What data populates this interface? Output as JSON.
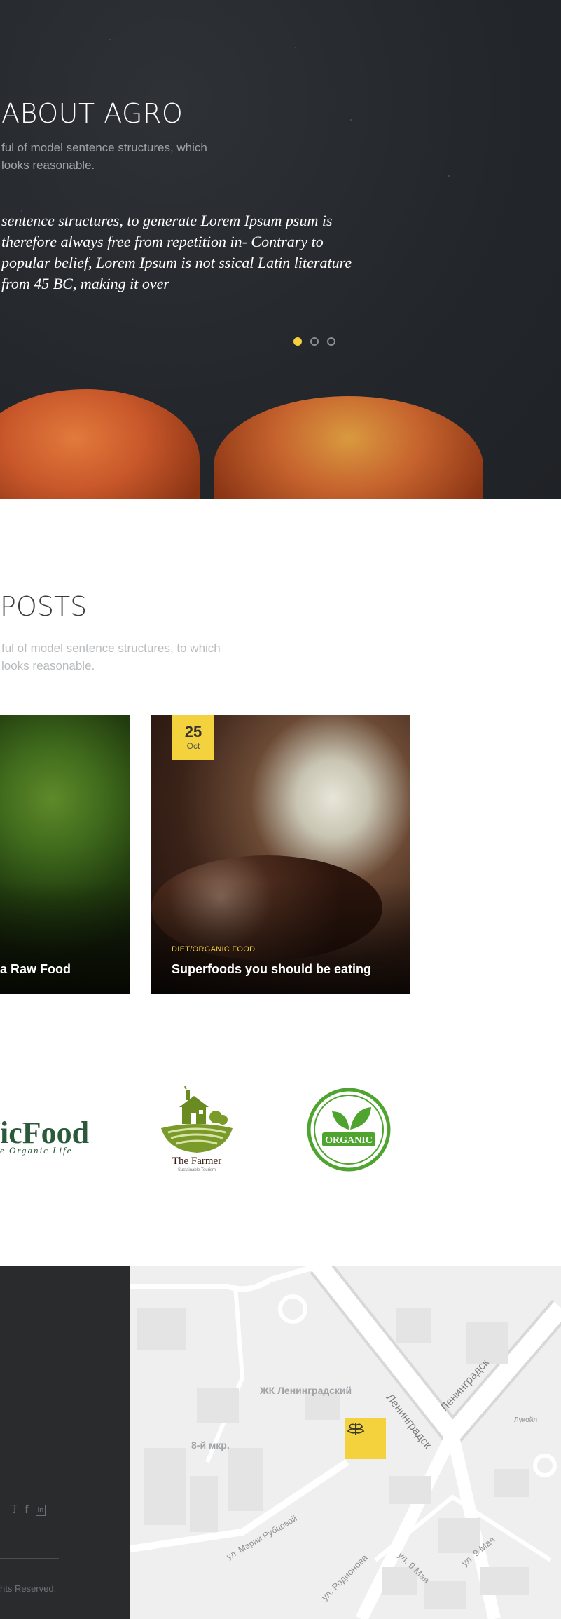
{
  "about": {
    "title": "ABOUT AGRO",
    "subtitle": "ful of model sentence structures, which looks reasonable.",
    "quote": "sentence structures, to generate Lorem Ipsum psum is therefore always free from repetition in- Contrary to popular belief, Lorem Ipsum is not ssical Latin literature from 45 BC, making it over",
    "slider_dots": 3,
    "active_dot": 1
  },
  "posts": {
    "title": "POSTS",
    "subtitle": "ful of model sentence structures, to which looks reasonable.",
    "cards": [
      {
        "title": "a Raw Food"
      },
      {
        "date_day": "25",
        "date_month": "Oct",
        "category": "DIET/ORGANIC FOOD",
        "title": "Superfoods you should be eating"
      }
    ]
  },
  "logos": {
    "organic_food": {
      "text": "icFood",
      "tagline": "e Organic Life"
    },
    "the_farmer": {
      "name": "The Farmer",
      "tagline": "Sustainable Tourism"
    },
    "organic_badge": {
      "text": "ORGANIC"
    }
  },
  "footer": {
    "social_icons": [
      "twitter-icon",
      "facebook-icon",
      "linkedin-icon"
    ],
    "copyright": "hts Reserved."
  },
  "map": {
    "labels": {
      "complex": "ЖК Ленинградский",
      "district": "8-й мкр.",
      "street1": "Ленинградск",
      "street2": "Ленинградск",
      "street3": "ул. Марии Рубцовой",
      "street4": "ул. 9 Мая",
      "street5": "ул. Родионова",
      "street6": "ул. 9 Мая",
      "place": "Лукойл"
    }
  },
  "colors": {
    "accent": "#f4d23e",
    "dark_bg": "#262a2e",
    "footer_bg": "#2a2b2d"
  }
}
